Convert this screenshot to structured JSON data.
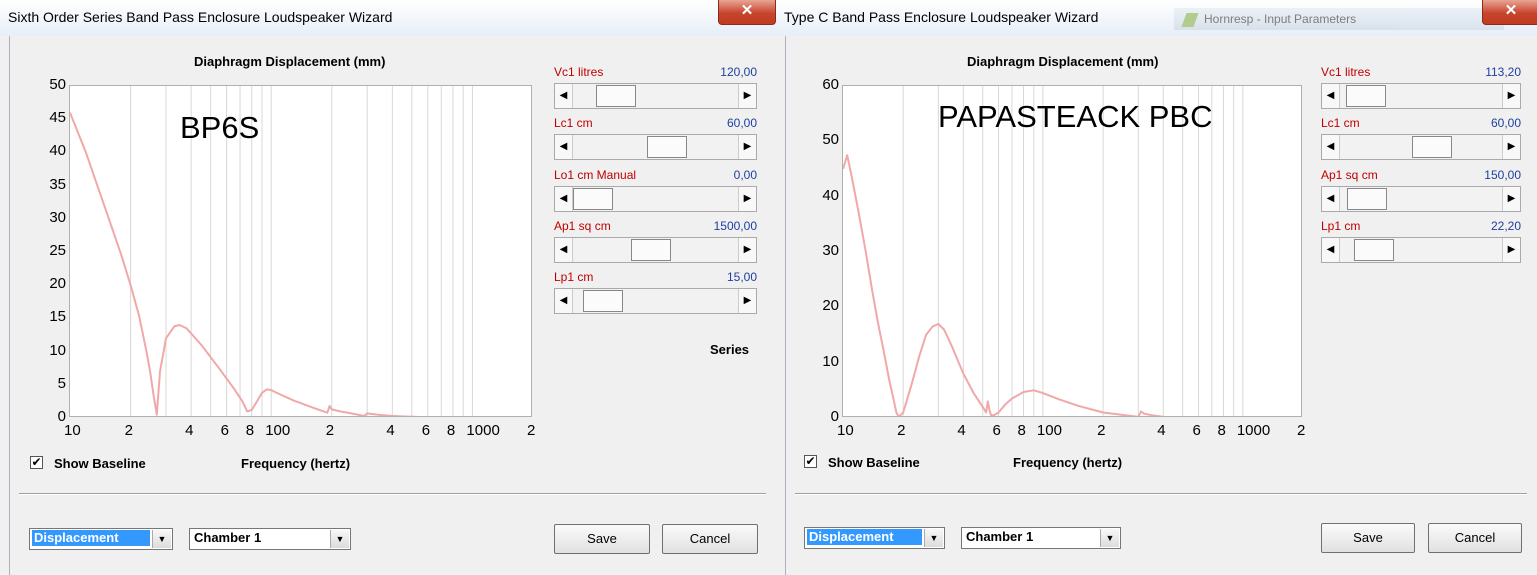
{
  "left": {
    "title": "Sixth Order Series Band Pass Enclosure Loudspeaker Wizard",
    "chart_title": "Diaphragm Displacement (mm)",
    "overlay_text": "BP6S",
    "x_axis_label": "Frequency (hertz)",
    "show_baseline_label": "Show Baseline",
    "show_baseline_checked": "✔",
    "series_label": "Series",
    "sliders": [
      {
        "label": "Vc1  litres",
        "value": "120,00",
        "fraction": 0.18
      },
      {
        "label": "Lc1  cm",
        "value": "60,00",
        "fraction": 0.58
      },
      {
        "label": "Lo1  cm  Manual",
        "value": "0,00",
        "fraction": 0.0
      },
      {
        "label": "Ap1  sq cm",
        "value": "1500,00",
        "fraction": 0.46
      },
      {
        "label": "Lp1  cm",
        "value": "15,00",
        "fraction": 0.08
      }
    ],
    "combo_mode": "Displacement",
    "combo_chamber": "Chamber 1",
    "save_label": "Save",
    "cancel_label": "Cancel"
  },
  "right": {
    "title": "Type C Band Pass Enclosure Loudspeaker Wizard",
    "background_window_title": "Hornresp - Input Parameters",
    "chart_title": "Diaphragm Displacement (mm)",
    "overlay_text": "PAPASTEACK PBC",
    "x_axis_label": "Frequency (hertz)",
    "show_baseline_label": "Show Baseline",
    "show_baseline_checked": "✔",
    "sliders": [
      {
        "label": "Vc1  litres",
        "value": "113,20",
        "fraction": 0.05
      },
      {
        "label": "Lc1  cm",
        "value": "60,00",
        "fraction": 0.58
      },
      {
        "label": "Ap1  sq cm",
        "value": "150,00",
        "fraction": 0.06
      },
      {
        "label": "Lp1  cm",
        "value": "22,20",
        "fraction": 0.11
      }
    ],
    "combo_mode": "Displacement",
    "combo_chamber": "Chamber 1",
    "save_label": "Save",
    "cancel_label": "Cancel"
  },
  "close_glyph": "✕",
  "arrow_left": "◀",
  "arrow_right": "▶",
  "combo_arrow": "▼",
  "colors": {
    "curve": "#f0a8a8",
    "slider_label": "#c00000",
    "slider_value": "#1f3f9f",
    "selection": "#3399ff"
  },
  "chart_data": [
    {
      "type": "line",
      "title": "Diaphragm Displacement (mm)",
      "xlabel": "Frequency (hertz)",
      "ylabel": "",
      "x_scale": "log",
      "xlim": [
        10,
        2000
      ],
      "ylim": [
        0,
        50
      ],
      "y_ticks": [
        "50",
        "45",
        "40",
        "35",
        "30",
        "25",
        "20",
        "15",
        "10",
        "5",
        "0"
      ],
      "x_ticks": [
        {
          "x": 10,
          "label": "10"
        },
        {
          "x": 20,
          "label": "2"
        },
        {
          "x": 40,
          "label": "4"
        },
        {
          "x": 60,
          "label": "6"
        },
        {
          "x": 80,
          "label": "8"
        },
        {
          "x": 100,
          "label": "100"
        },
        {
          "x": 200,
          "label": "2"
        },
        {
          "x": 400,
          "label": "4"
        },
        {
          "x": 600,
          "label": "6"
        },
        {
          "x": 800,
          "label": "8"
        },
        {
          "x": 1000,
          "label": "1000"
        },
        {
          "x": 2000,
          "label": "2"
        }
      ],
      "grid": true,
      "series": [
        {
          "x": [
            10,
            12,
            15,
            18,
            20,
            22,
            24,
            25,
            26,
            27,
            28,
            30,
            33,
            35,
            38,
            45,
            55,
            65,
            72,
            76,
            80,
            85,
            90,
            95,
            100,
            110,
            130,
            160,
            190,
            195,
            200,
            220,
            250,
            290,
            300,
            340,
            400,
            500,
            600,
            700
          ],
          "y": [
            46,
            40,
            31.5,
            24.5,
            20,
            15.5,
            10,
            7,
            3.5,
            0.5,
            7,
            12,
            13.8,
            14,
            13.5,
            11,
            7.5,
            4.5,
            2.5,
            1,
            1.2,
            2.5,
            3.8,
            4.3,
            4.2,
            3.6,
            2.6,
            1.6,
            0.8,
            1.8,
            1.3,
            1,
            0.7,
            0.3,
            0.7,
            0.5,
            0.3,
            0.2,
            0.1,
            0.1
          ]
        }
      ]
    },
    {
      "type": "line",
      "title": "Diaphragm Displacement (mm)",
      "xlabel": "Frequency (hertz)",
      "ylabel": "",
      "x_scale": "log",
      "xlim": [
        10,
        2000
      ],
      "ylim": [
        0,
        60
      ],
      "y_ticks": [
        "60",
        "50",
        "40",
        "30",
        "20",
        "10",
        "0"
      ],
      "x_ticks": [
        {
          "x": 10,
          "label": "10"
        },
        {
          "x": 20,
          "label": "2"
        },
        {
          "x": 40,
          "label": "4"
        },
        {
          "x": 60,
          "label": "6"
        },
        {
          "x": 80,
          "label": "8"
        },
        {
          "x": 100,
          "label": "100"
        },
        {
          "x": 200,
          "label": "2"
        },
        {
          "x": 400,
          "label": "4"
        },
        {
          "x": 600,
          "label": "6"
        },
        {
          "x": 800,
          "label": "8"
        },
        {
          "x": 1000,
          "label": "1000"
        },
        {
          "x": 2000,
          "label": "2"
        }
      ],
      "grid": true,
      "series": [
        {
          "x": [
            10,
            10.5,
            11,
            12,
            13,
            14,
            15,
            16,
            17,
            18,
            18.5,
            19,
            20,
            22,
            24,
            26,
            28,
            30,
            32,
            35,
            40,
            45,
            50,
            52,
            53,
            54,
            55,
            57,
            60,
            65,
            70,
            80,
            90,
            100,
            120,
            150,
            200,
            300,
            310,
            320,
            350,
            400,
            500,
            600,
            700
          ],
          "y": [
            45,
            47.5,
            44,
            37,
            30,
            23,
            17,
            12,
            7,
            3,
            1,
            0.2,
            1,
            6,
            11,
            15,
            16.5,
            17,
            16,
            13,
            8,
            4.5,
            2,
            1,
            3,
            1.5,
            0.5,
            0.5,
            1,
            2.5,
            3.5,
            4.7,
            5,
            4.5,
            3.4,
            2.2,
            1,
            0.2,
            1.2,
            0.8,
            0.5,
            0.2,
            0.1,
            0.1,
            0.1
          ]
        }
      ]
    }
  ]
}
